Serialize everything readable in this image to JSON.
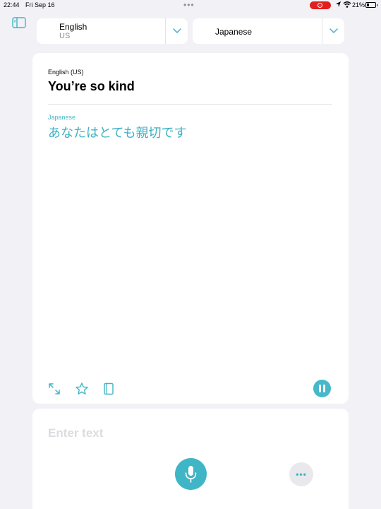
{
  "status_bar": {
    "time": "22:44",
    "date": "Fri Sep 16",
    "dots": "•••",
    "battery_percent": "21%"
  },
  "header": {
    "source_language": {
      "name": "English",
      "region": "US"
    },
    "target_language": {
      "name": "Japanese"
    }
  },
  "translation": {
    "source_label": "English (US)",
    "source_text": "You’re so kind",
    "target_label": "Japanese",
    "target_text": "あなたはとても親切です"
  },
  "input": {
    "placeholder": "Enter text",
    "more_label": "•••"
  },
  "icons": {
    "sidebar": "sidebar-icon",
    "expand": "expand-icon",
    "favorite": "star-icon",
    "dictionary": "book-icon",
    "pause": "pause-icon",
    "mic": "microphone-icon",
    "more": "more-icon"
  },
  "colors": {
    "accent": "#3fb5c6",
    "background": "#f1f1f6",
    "record_indicator": "#e0201f"
  }
}
